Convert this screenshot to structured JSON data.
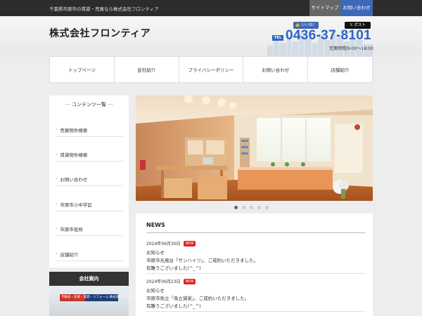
{
  "topbar": {
    "tagline": "千葉県市原市の賃貸・売買なら株式会社フロンティア",
    "sitemap_label": "サイトマップ",
    "contact_label": "お問い合わせ"
  },
  "header": {
    "company_name": "株式会社フロンティア",
    "like_label": "いいね！",
    "post_label": "ポスト",
    "tel_badge": "TEL",
    "tel_number": "0436-37-8101",
    "hours": "営業時間/9:00〜18:00"
  },
  "nav": {
    "items": [
      {
        "label": "トップページ"
      },
      {
        "label": "会社紹介"
      },
      {
        "label": "プライバシーポリシー"
      },
      {
        "label": "お問い合わせ"
      },
      {
        "label": "店舗紹介"
      }
    ]
  },
  "sidebar": {
    "title": "コンテンツ一覧",
    "items": [
      {
        "label": "売買物件検索"
      },
      {
        "label": "賃貸物件検索"
      },
      {
        "label": "お問い合わせ"
      },
      {
        "label": "市原市小中学区"
      },
      {
        "label": "市原市役所"
      },
      {
        "label": "店舗紹介"
      }
    ],
    "company_heading": "会社案内",
    "shop_sign": "不動産・売買・賃貸・リフォーム  株式会社 フロンティア"
  },
  "slider": {
    "slide_count": 5,
    "active_index": 0
  },
  "news": {
    "title": "NEWS",
    "badge": "NEW",
    "entries": [
      {
        "date": "2024年06月30日",
        "category": "お知らせ",
        "body": "市原市光風台「サンハイツ」、ご成約いただきました。",
        "thanks": "有難うございました(^_^)"
      },
      {
        "date": "2024年06月23日",
        "category": "お知らせ",
        "body": "市原市馬立「馬立貸家」、ご成約いただきました。",
        "thanks": "有難うございました(^_^)"
      }
    ]
  },
  "colors": {
    "topbar_bg": "#2c2c2c",
    "accent_blue": "#2a64c4",
    "new_badge": "#d9261c",
    "company_head_bg": "#333333"
  }
}
